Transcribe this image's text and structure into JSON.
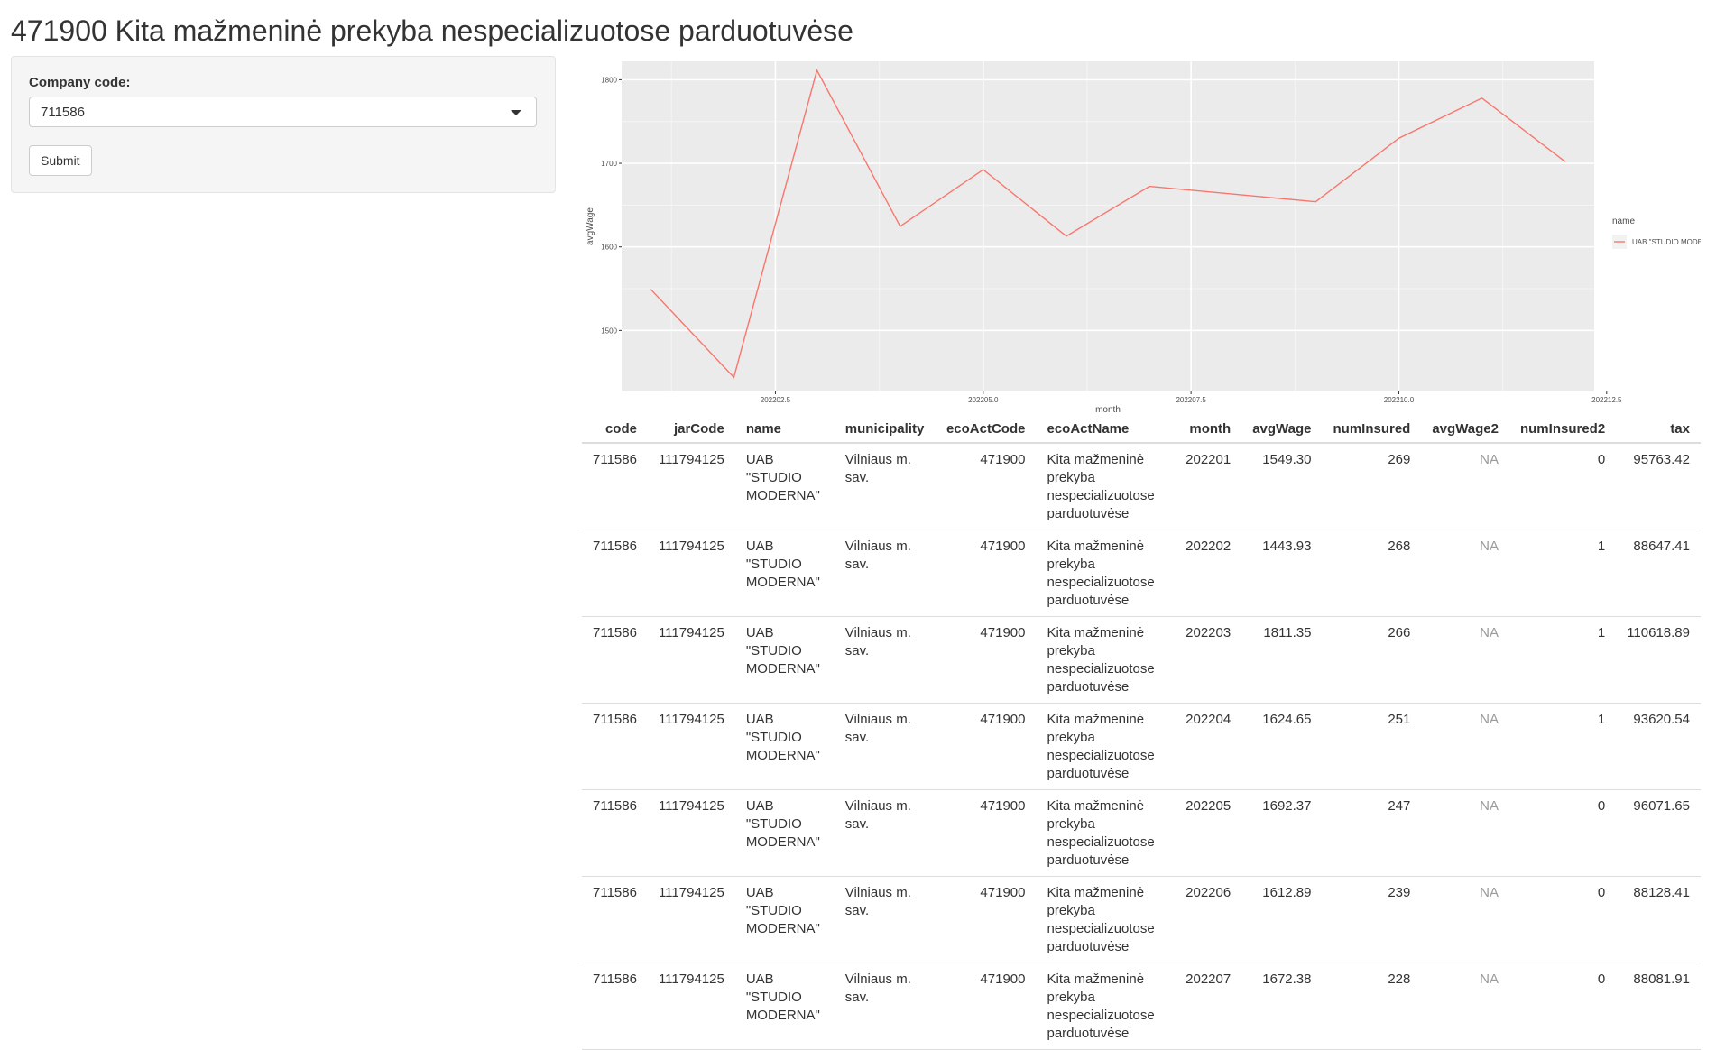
{
  "page": {
    "title": "471900 Kita mažmeninė prekyba nespecializuotose parduotuvėse"
  },
  "sidebar": {
    "company_label": "Company code:",
    "company_value": "711586",
    "submit_label": "Submit"
  },
  "chart_data": {
    "type": "line",
    "xlabel": "month",
    "ylabel": "avgWage",
    "x_ticks": [
      "202202.5",
      "202205.0",
      "202207.5",
      "202210.0",
      "202212.5"
    ],
    "y_ticks": [
      "1500",
      "1600",
      "1700",
      "1800"
    ],
    "x_tick_values": [
      202202.5,
      202205.0,
      202207.5,
      202210.0,
      202212.5
    ],
    "y_tick_values": [
      1500,
      1600,
      1700,
      1800
    ],
    "xlim": [
      202200.65,
      202212.35
    ],
    "ylim": [
      1427,
      1822
    ],
    "grid": true,
    "legend": {
      "title": "name",
      "placement": "right"
    },
    "series": [
      {
        "name": "UAB \"STUDIO MODERNA\"",
        "color": "#f8766d",
        "x": [
          202201,
          202202,
          202203,
          202204,
          202205,
          202206,
          202207,
          202209,
          202210,
          202211,
          202212
        ],
        "y": [
          1549.3,
          1443.93,
          1811.35,
          1624.65,
          1692.37,
          1612.89,
          1672.38,
          1654,
          1730,
          1778,
          1702
        ]
      }
    ]
  },
  "table": {
    "columns": [
      "code",
      "jarCode",
      "name",
      "municipality",
      "ecoActCode",
      "ecoActName",
      "month",
      "avgWage",
      "numInsured",
      "avgWage2",
      "numInsured2",
      "tax"
    ],
    "rows": [
      [
        "711586",
        "111794125",
        "UAB \"STUDIO MODERNA\"",
        "Vilniaus m. sav.",
        "471900",
        "Kita mažmeninė prekyba nespecializuotose parduotuvėse",
        "202201",
        "1549.30",
        "269",
        "NA",
        "0",
        "95763.42"
      ],
      [
        "711586",
        "111794125",
        "UAB \"STUDIO MODERNA\"",
        "Vilniaus m. sav.",
        "471900",
        "Kita mažmeninė prekyba nespecializuotose parduotuvėse",
        "202202",
        "1443.93",
        "268",
        "NA",
        "1",
        "88647.41"
      ],
      [
        "711586",
        "111794125",
        "UAB \"STUDIO MODERNA\"",
        "Vilniaus m. sav.",
        "471900",
        "Kita mažmeninė prekyba nespecializuotose parduotuvėse",
        "202203",
        "1811.35",
        "266",
        "NA",
        "1",
        "110618.89"
      ],
      [
        "711586",
        "111794125",
        "UAB \"STUDIO MODERNA\"",
        "Vilniaus m. sav.",
        "471900",
        "Kita mažmeninė prekyba nespecializuotose parduotuvėse",
        "202204",
        "1624.65",
        "251",
        "NA",
        "1",
        "93620.54"
      ],
      [
        "711586",
        "111794125",
        "UAB \"STUDIO MODERNA\"",
        "Vilniaus m. sav.",
        "471900",
        "Kita mažmeninė prekyba nespecializuotose parduotuvėse",
        "202205",
        "1692.37",
        "247",
        "NA",
        "0",
        "96071.65"
      ],
      [
        "711586",
        "111794125",
        "UAB \"STUDIO MODERNA\"",
        "Vilniaus m. sav.",
        "471900",
        "Kita mažmeninė prekyba nespecializuotose parduotuvėse",
        "202206",
        "1612.89",
        "239",
        "NA",
        "0",
        "88128.41"
      ],
      [
        "711586",
        "111794125",
        "UAB \"STUDIO MODERNA\"",
        "Vilniaus m. sav.",
        "471900",
        "Kita mažmeninė prekyba nespecializuotose parduotuvėse",
        "202207",
        "1672.38",
        "228",
        "NA",
        "0",
        "88081.91"
      ]
    ]
  }
}
